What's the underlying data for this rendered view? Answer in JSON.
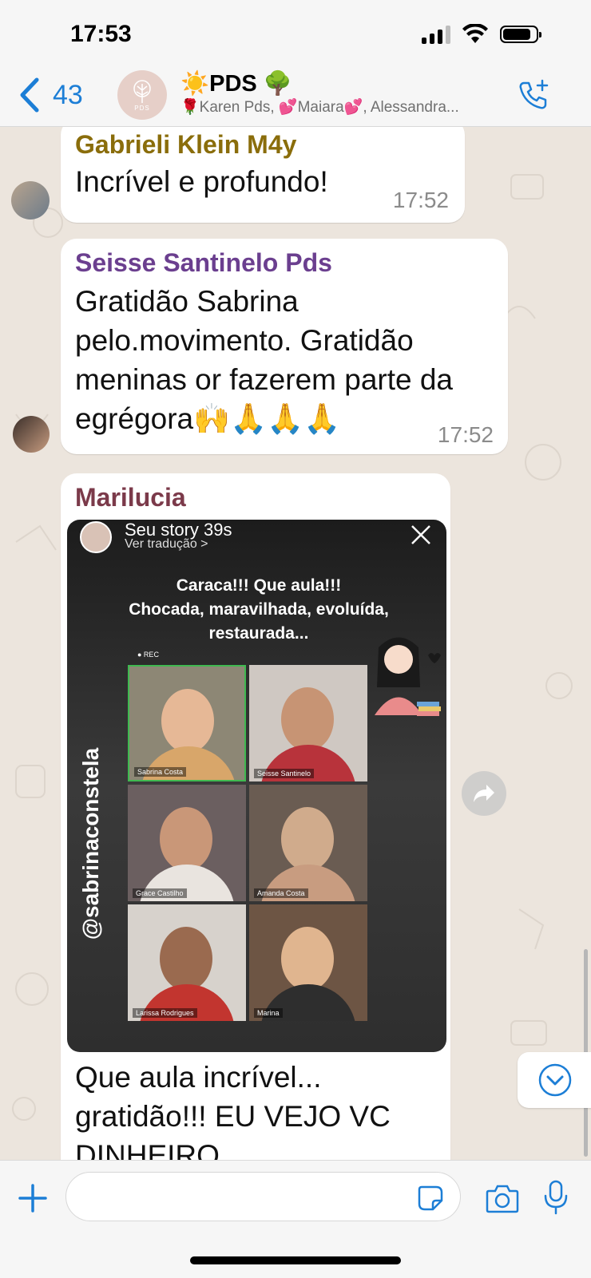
{
  "status_bar": {
    "time": "17:53"
  },
  "header": {
    "back_count": "43",
    "title": "☀️PDS 🌳",
    "members": "🌹Karen Pds, 💕Maiara💕, Alessandra..."
  },
  "group_avatar": {
    "mini_label": "PDS"
  },
  "messages": [
    {
      "sender": "Gabrieli Klein M4y",
      "sender_color": "#8a6d0b",
      "text": "Incrível e profundo!",
      "time": "17:52"
    },
    {
      "sender": "Seisse Santinelo Pds",
      "sender_color": "#6b3f8f",
      "text_lines": [
        "Gratidão Sabrina",
        "pelo.movimento.  Gratidão",
        "meninas or fazerem parte da",
        "egrégora🙌🙏🙏🙏"
      ],
      "time": "17:52"
    },
    {
      "sender": "Marilucia",
      "sender_color": "#7b3a4a",
      "caption_lines": [
        "Que aula incrível...",
        "gratidão!!! EU VEJO VC",
        "DINHEIRO..."
      ]
    }
  ],
  "story": {
    "title": "Seu story  39s",
    "subtitle": "Ver tradução >",
    "caption_lines": [
      "Caraca!!! Que aula!!!",
      "Chocada, maravilhada, evoluída,",
      "restaurada..."
    ],
    "handle": "@sabrinaconstela",
    "rec_label": "● REC",
    "tiles": [
      "Sabrina Costa",
      "Seisse Santinelo",
      "Grace Castilho",
      "Amanda Costa",
      "Larissa Rodrigues",
      "Marina"
    ]
  },
  "composer": {
    "placeholder": ""
  }
}
